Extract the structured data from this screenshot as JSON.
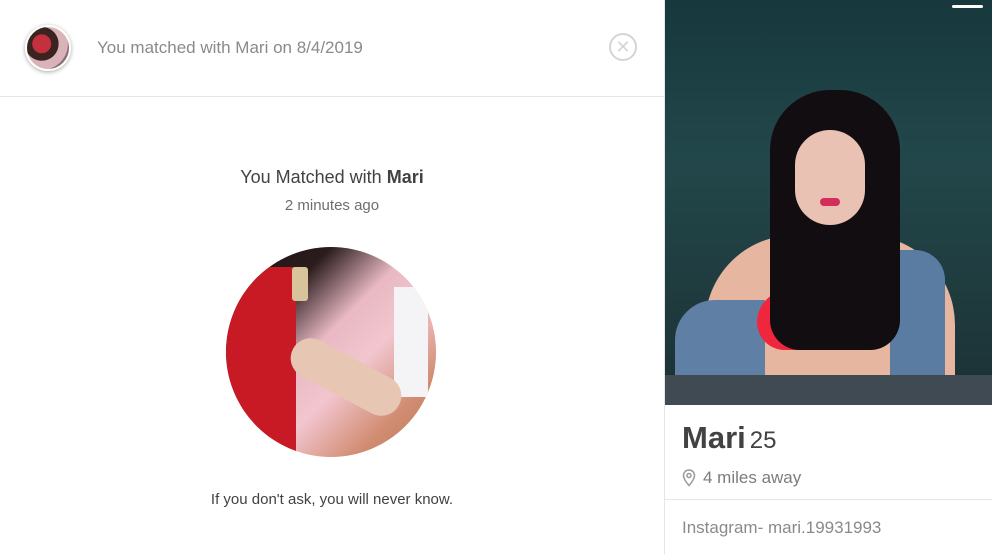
{
  "header": {
    "match_text": "You matched with Mari on 8/4/2019",
    "close_symbol": "✕"
  },
  "match": {
    "title_prefix": "You Matched with ",
    "title_name": "Mari",
    "time": "2 minutes ago",
    "bio": "If you don't ask, you will never know."
  },
  "profile": {
    "name": "Mari",
    "age": "25",
    "distance": "4 miles away",
    "instagram": "Instagram- mari.19931993"
  },
  "icons": {
    "close": "close-circle-icon",
    "location": "location-pin-icon"
  }
}
